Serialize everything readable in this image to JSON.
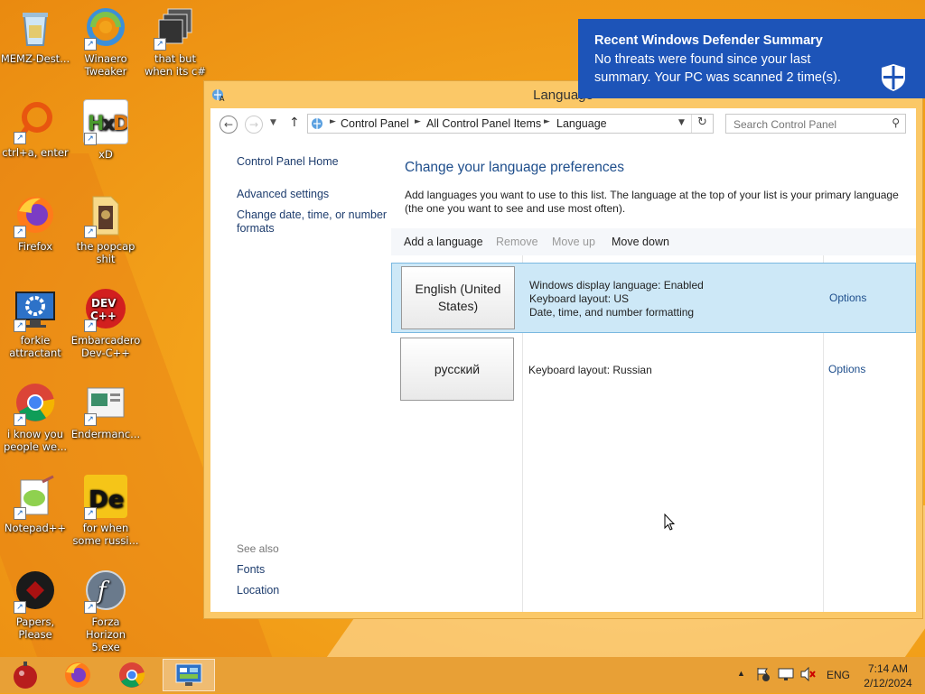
{
  "desktop": {
    "icons": [
      {
        "label": "MEMZ-Dest...",
        "icon": "recycle-bin-icon"
      },
      {
        "label": "Winaero Tweaker",
        "icon": "winaero-tweaker-icon"
      },
      {
        "label": "that but when its c#",
        "icon": "stacked-windows-icon"
      },
      {
        "label": "ctrl+a, enter",
        "icon": "orange-ring-icon"
      },
      {
        "label": "xD",
        "icon": "hxd-icon"
      },
      {
        "label": "Firefox",
        "icon": "firefox-icon"
      },
      {
        "label": "the popcap shit",
        "icon": "folder-icon"
      },
      {
        "label": "forkie attractant",
        "icon": "gear-monitor-icon"
      },
      {
        "label": "Embarcadero Dev-C++",
        "icon": "dev-cpp-icon"
      },
      {
        "label": "i know you people we...",
        "icon": "chrome-icon"
      },
      {
        "label": "Endermanc...",
        "icon": "screenshot-icon"
      },
      {
        "label": "Notepad++",
        "icon": "notepad-plus-plus-icon"
      },
      {
        "label": "for when some russi...",
        "icon": "de-icon"
      },
      {
        "label": "Papers, Please",
        "icon": "papers-please-icon"
      },
      {
        "label": "Forza Horizon 5.exe",
        "icon": "flash-icon"
      }
    ]
  },
  "window": {
    "title": "Language",
    "address": {
      "crumbs": [
        "Control Panel",
        "All Control Panel Items",
        "Language"
      ],
      "search_placeholder": "Search Control Panel"
    },
    "left_nav": {
      "home": "Control Panel Home",
      "advanced": "Advanced settings",
      "change_date": "Change date, time, or number formats",
      "see_also": "See also",
      "fonts": "Fonts",
      "location": "Location"
    },
    "main": {
      "title": "Change your language preferences",
      "description": "Add languages you want to use to this list. The language at the top of your list is your primary language (the one you want to see and use most often).",
      "toolbar": {
        "add": "Add a language",
        "remove": "Remove",
        "move_up": "Move up",
        "move_down": "Move down"
      },
      "languages": [
        {
          "name": "English (United States)",
          "details": [
            "Windows display language: Enabled",
            "Keyboard layout: US",
            "Date, time, and number formatting"
          ],
          "options": "Options"
        },
        {
          "name": "русский",
          "details": [
            "Keyboard layout: Russian"
          ],
          "options": "Options"
        }
      ]
    }
  },
  "notification": {
    "title": "Recent Windows Defender Summary",
    "body": "No threats were found since your last summary. Your PC was scanned 2 time(s).",
    "icon": "defender-shield-icon",
    "color": "#1d54b8"
  },
  "taskbar": {
    "apps": [
      "memz-orb-icon",
      "firefox-icon",
      "chrome-icon",
      "control-panel-icon"
    ],
    "language": "ENG",
    "time": "7:14 AM",
    "date": "2/12/2024"
  }
}
